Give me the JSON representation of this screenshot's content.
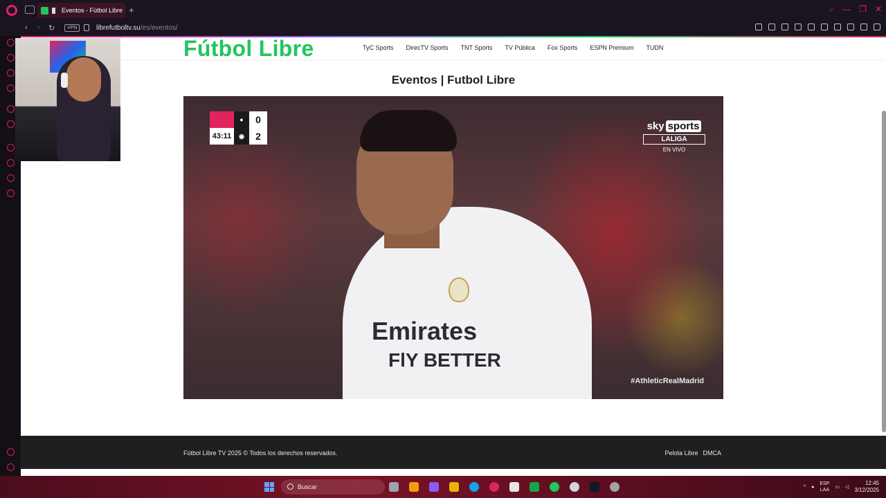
{
  "browser": {
    "tab_title": "Eventos - Fútbol Libre",
    "new_tab": "+",
    "vpn_label": "VPN",
    "url_host": "librefutboltv.su",
    "url_path": "/es/eventos/"
  },
  "site": {
    "logo": "Fútbol Libre",
    "nav": [
      "TyC Sports",
      "DirecTV Sports",
      "TNT Sports",
      "TV Pública",
      "Fox Sports",
      "ESPN Premium",
      "TUDN"
    ],
    "page_title": "Eventos | Futbol Libre"
  },
  "player": {
    "scoreboard": {
      "time": "43:11",
      "home_score": "0",
      "away_score": "2"
    },
    "sponsor_line1": "Emirates",
    "sponsor_line2": "FlY BETTER",
    "broadcaster": "sky",
    "broadcaster_tag": "sports",
    "league": "LALIGA",
    "live_label": "EN VIVO",
    "hashtag": "#AthleticRealMadrid"
  },
  "footer": {
    "copyright": "Fútbol Libre TV 2025 © Todos los derechos reservados.",
    "links": [
      "Pelota Libre",
      "DMCA"
    ]
  },
  "taskbar": {
    "search_placeholder": "Buscar",
    "lang_top": "ESP",
    "lang_bottom": "LAA",
    "time": "12:45",
    "date": "3/12/2025"
  },
  "colors": {
    "brand_green": "#22c55e",
    "opera_red": "#e0245e",
    "footer_bg": "#1f1f1f"
  }
}
